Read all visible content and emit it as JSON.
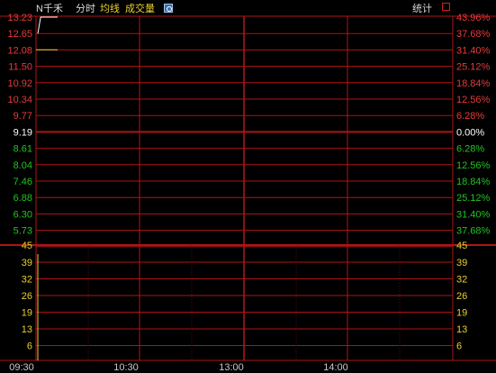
{
  "header": {
    "stock_name": "N千禾",
    "tab_fenshi": "分时",
    "tab_junxian": "均线",
    "tab_chengjiaoliang": "成交量",
    "stats_label": "统计",
    "camera_icon": "camera-icon",
    "close_icon": "close-box-icon"
  },
  "colors": {
    "up": "#e83a3a",
    "down": "#22c322",
    "neutral": "#ffffff",
    "volume": "#e8d030",
    "grid": "#b01414",
    "time": "#c8c8c8",
    "background": "#000000"
  },
  "price_axis": {
    "left": [
      "13.23",
      "12.65",
      "12.08",
      "11.50",
      "10.92",
      "10.34",
      "9.77",
      "9.19",
      "8.61",
      "8.04",
      "7.46",
      "6.88",
      "6.30",
      "5.73"
    ],
    "right": [
      "43.96%",
      "37.68%",
      "31.40%",
      "25.12%",
      "18.84%",
      "12.56%",
      "6.28%",
      "0.00%",
      "6.28%",
      "12.56%",
      "18.84%",
      "25.12%",
      "31.40%",
      "37.68%"
    ],
    "directions": [
      "up",
      "up",
      "up",
      "up",
      "up",
      "up",
      "up",
      "neutral",
      "down",
      "down",
      "down",
      "down",
      "down",
      "down"
    ]
  },
  "volume_axis": {
    "labels": [
      "45",
      "39",
      "32",
      "26",
      "19",
      "13",
      "6"
    ]
  },
  "time_axis": {
    "labels": [
      "09:30",
      "10:30",
      "13:00",
      "14:00"
    ]
  },
  "chart_data": {
    "type": "line",
    "title": "",
    "xlabel": "",
    "ylabel": "",
    "prev_close": 9.19,
    "ylim": [
      5.73,
      13.23
    ],
    "series": [
      {
        "x": [
          "09:30",
          "09:31",
          "09:32",
          "09:33",
          "09:34",
          "09:35",
          "09:36",
          "09:37"
        ],
        "values": [
          12.65,
          13.23,
          13.23,
          13.23,
          13.23,
          13.23,
          13.23,
          13.23
        ]
      },
      {
        "x": [
          "09:30",
          "09:37"
        ],
        "values": [
          12.08,
          12.08
        ]
      }
    ],
    "volume_ylim": [
      0,
      45
    ]
  }
}
